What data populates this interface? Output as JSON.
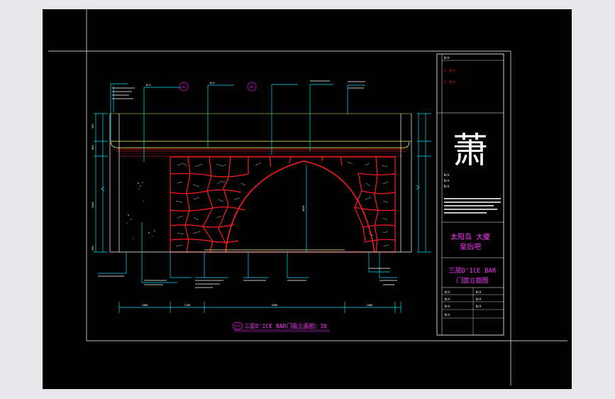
{
  "drawing": {
    "title_caption": "三层D'ICE BAR门面立面图：30",
    "title_ref": "N/A",
    "callouts_top": [
      {
        "label": "N/A",
        "ref": "01"
      },
      {
        "label": "N/A",
        "ref": "02"
      }
    ],
    "dims_bottom": [
      "1800",
      "1200",
      "3600",
      "1800"
    ],
    "dims_left": [
      "500",
      "900",
      "2400",
      "450"
    ],
    "arch_height": "3000"
  },
  "titleblock": {
    "notes_header": "N/A",
    "notes": [
      "1. N/A",
      "2. N/A"
    ],
    "logo_glyph": "萧",
    "company_lines": [
      "N/A",
      "N/A",
      "N/A"
    ],
    "project_name_line1": "太阳岛 大厦",
    "project_name_line2": "皇后吧",
    "sheet_title_line1": "三层D'ICE BAR",
    "sheet_title_line2": "门面立面图",
    "table": [
      [
        "N/A",
        "N/A"
      ],
      [
        "N/A",
        "N/A"
      ],
      [
        "N/A",
        "N/A"
      ],
      [
        "N/A",
        "-"
      ]
    ]
  },
  "colors": {
    "background": "#000000",
    "frame": "#ffffff",
    "stone": "#ff1a1a",
    "dimension": "#00e5ff",
    "annotation": "#ff00ff",
    "cornice": "#ffff66"
  }
}
